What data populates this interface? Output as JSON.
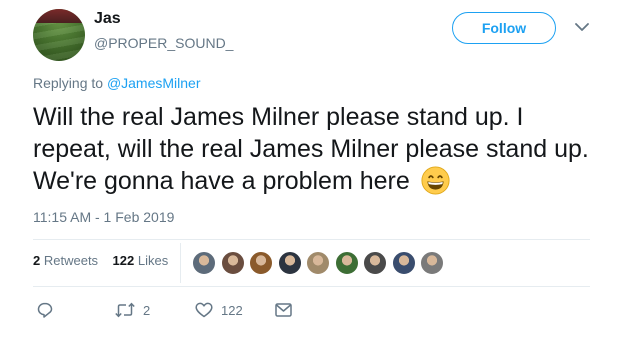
{
  "user": {
    "display_name": "Jas",
    "handle": "@PROPER_SOUND_"
  },
  "follow_label": "Follow",
  "reply": {
    "prefix": "Replying to ",
    "mention": "@JamesMilner"
  },
  "tweet": {
    "text": "Will the real James Milner please stand up. I repeat, will the real James Milner please stand up. We're gonna have a problem here",
    "emoji": "grinning-face-emoji",
    "timestamp": "11:15 AM - 1 Feb 2019"
  },
  "stats": {
    "retweets_count": "2",
    "retweets_label": "Retweets",
    "likes_count": "122",
    "likes_label": "Likes"
  },
  "liker_avatar_colors": [
    "#5d6b7a",
    "#6a4d3f",
    "#8a5a2b",
    "#2c3440",
    "#a08a6a",
    "#3d6e35",
    "#4a4a4a",
    "#3a4d6e",
    "#7a7a7a"
  ],
  "actions": {
    "reply_icon": "reply-icon",
    "retweet_icon": "retweet-icon",
    "retweet_count": "2",
    "like_icon": "heart-icon",
    "like_count": "122",
    "dm_icon": "envelope-icon"
  },
  "colors": {
    "accent": "#1da1f2",
    "secondary_text": "#657786",
    "divider": "#e6ecf0"
  }
}
